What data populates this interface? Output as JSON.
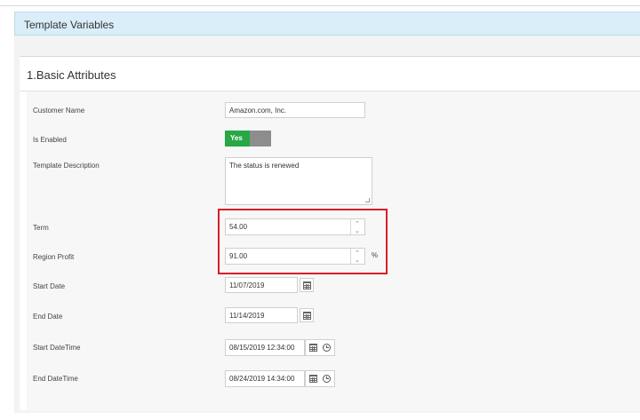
{
  "header": {
    "title": "Template Variables"
  },
  "section": {
    "title": "1.Basic Attributes"
  },
  "fields": {
    "customer_name": {
      "label": "Customer Name",
      "value": "Amazon.com, Inc."
    },
    "is_enabled": {
      "label": "Is Enabled",
      "toggle_label": "Yes",
      "state": "on"
    },
    "template_description": {
      "label": "Template Description",
      "value": "The status is renewed"
    },
    "term": {
      "label": "Term",
      "value": "54.00"
    },
    "region_profit": {
      "label": "Region Profit",
      "value": "91.00",
      "unit": "%"
    },
    "start_date": {
      "label": "Start Date",
      "value": "11/07/2019"
    },
    "end_date": {
      "label": "End Date",
      "value": "11/14/2019"
    },
    "start_datetime": {
      "label": "Start DateTime",
      "value": "08/15/2019 12:34:00"
    },
    "end_datetime": {
      "label": "End DateTime",
      "value": "08/24/2019 14:34:00"
    }
  },
  "icons": {
    "stepper_up": "chevron-up-icon",
    "stepper_down": "chevron-down-icon",
    "calendar": "calendar-icon",
    "clock": "clock-icon"
  },
  "colors": {
    "header_bg": "#d9eef8",
    "toggle_on": "#27a844",
    "highlight": "#d81f26"
  }
}
